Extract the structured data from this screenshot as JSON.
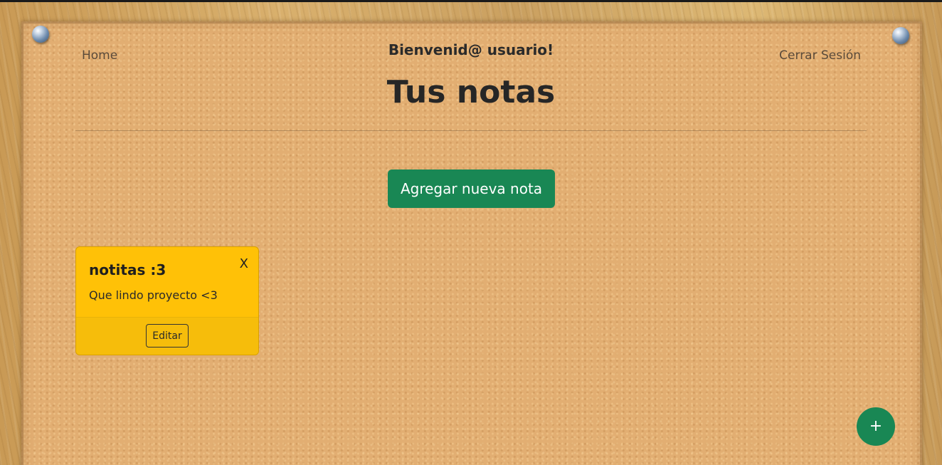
{
  "nav": {
    "home_label": "Home",
    "logout_label": "Cerrar Sesión",
    "welcome": "Bienvenid@ usuario!"
  },
  "header": {
    "title": "Tus notas"
  },
  "actions": {
    "add_note_label": "Agregar nueva nota",
    "fab_label": "+"
  },
  "notes": [
    {
      "title": "notitas :3",
      "body": "Que lindo proyecto <3",
      "close_label": "X",
      "edit_label": "Editar"
    }
  ],
  "colors": {
    "primary": "#198754",
    "note": "#ffc107",
    "board": "#e2ae72"
  },
  "icons": {
    "pin": "pushpin-icon",
    "fab": "plus-icon"
  }
}
